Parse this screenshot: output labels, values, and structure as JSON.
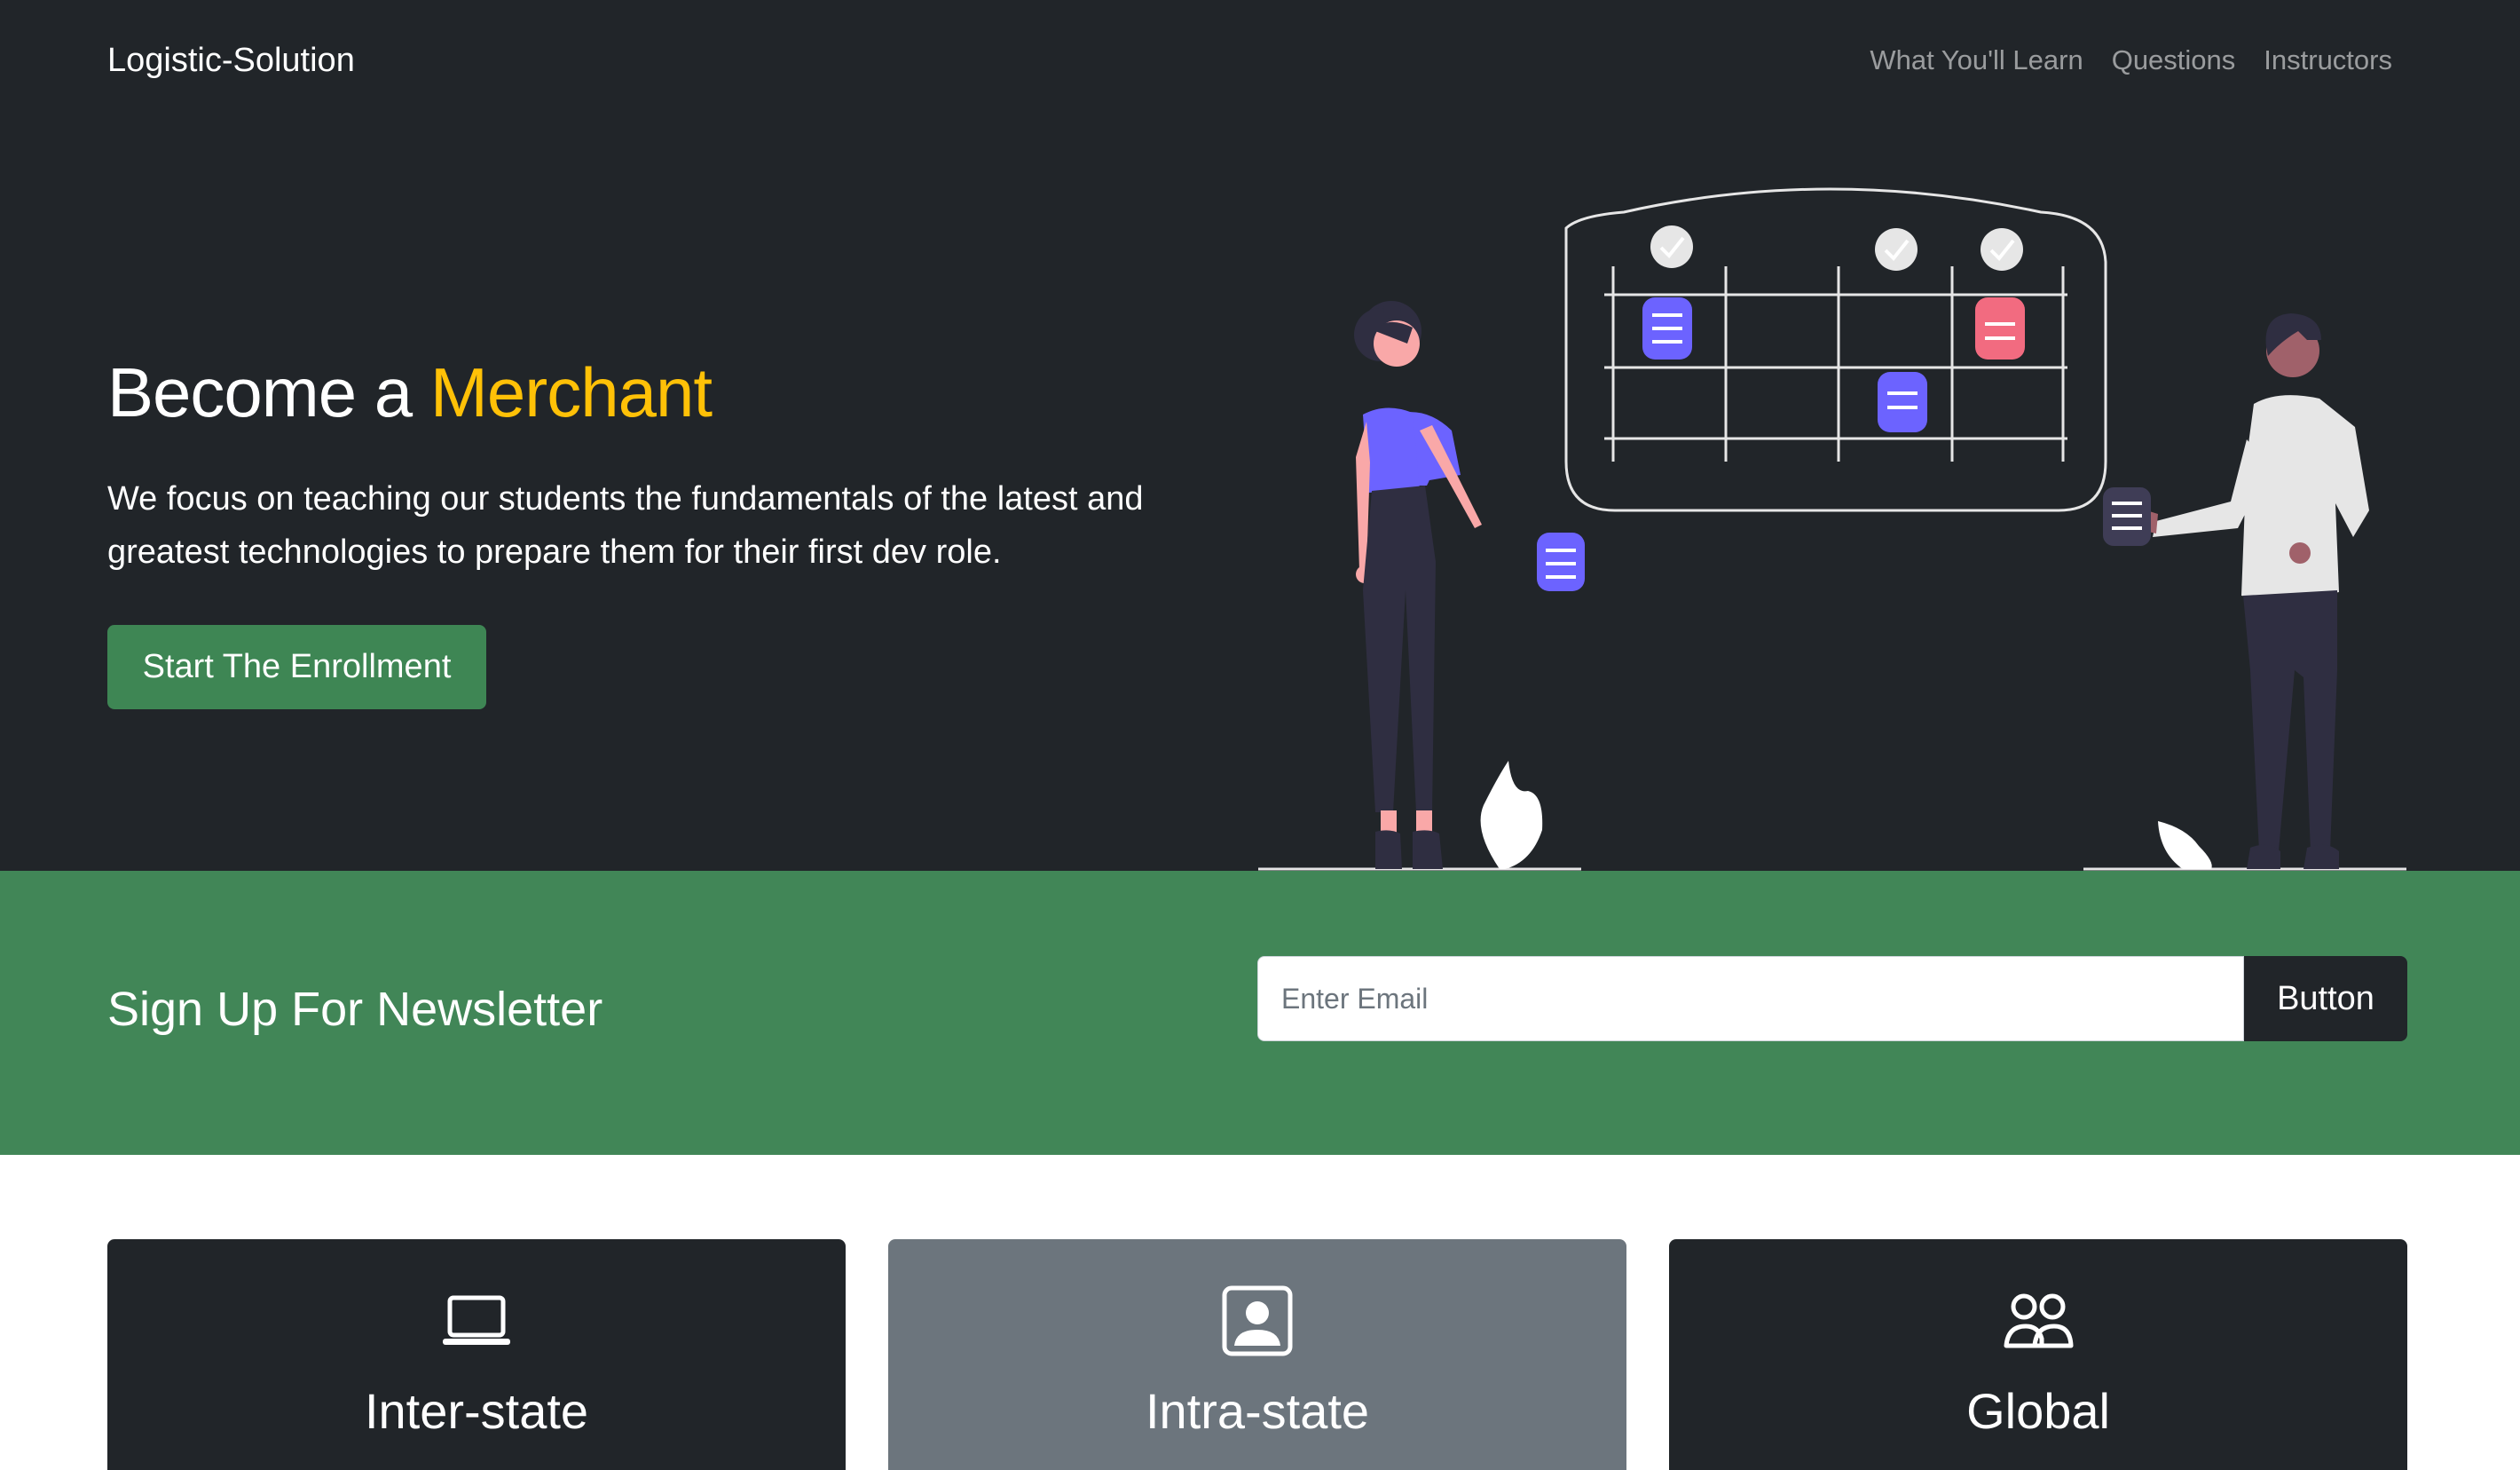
{
  "nav": {
    "brand": "Logistic-Solution",
    "links": [
      "What You'll Learn",
      "Questions",
      "Instructors"
    ]
  },
  "hero": {
    "title_prefix": "Become a ",
    "title_highlight": "Merchant",
    "lead": "We focus on teaching our students the fundamentals of the latest and greatest technologies to prepare them for their first dev role.",
    "cta_label": "Start The Enrollment"
  },
  "newsletter": {
    "title": "Sign Up For Newsletter",
    "email_placeholder": "Enter Email",
    "email_value": "",
    "button_label": "Button"
  },
  "cards": [
    {
      "title": "Inter-state",
      "icon": "laptop-icon"
    },
    {
      "title": "Intra-state",
      "icon": "person-badge-icon"
    },
    {
      "title": "Global",
      "icon": "people-icon"
    }
  ],
  "colors": {
    "dark": "#212529",
    "accent_yellow": "#ffc107",
    "success_green": "#418657",
    "secondary_grey": "#6c757d",
    "illustration_purple": "#6c63ff",
    "illustration_red": "#f26b80"
  }
}
